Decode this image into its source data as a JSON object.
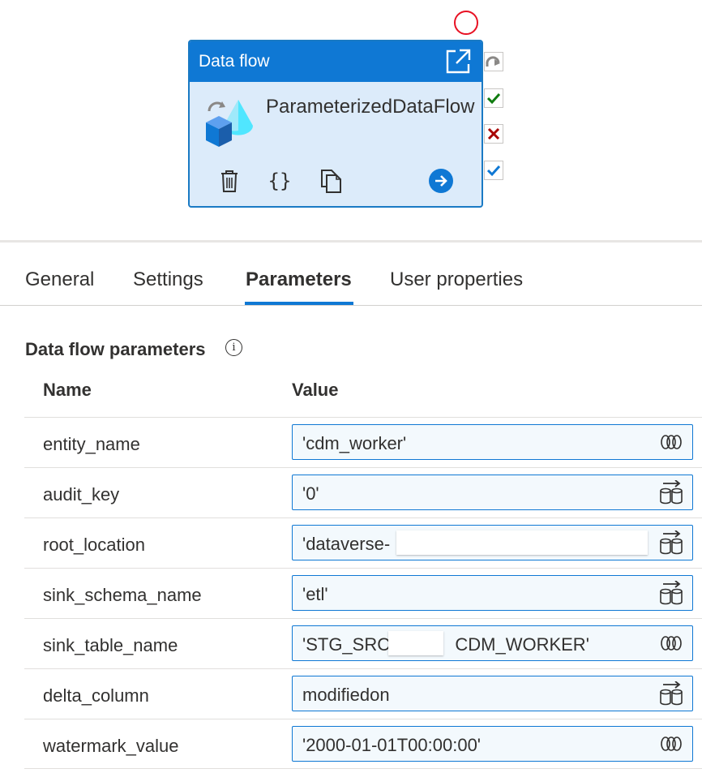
{
  "activity_card": {
    "header_title": "Data flow",
    "activity_name": "ParameterizedDataFlow",
    "status": "not-run",
    "header_icon": "open-external-icon",
    "body_icon": "data-flow-icon",
    "actions": [
      "delete-icon",
      "code-braces-icon",
      "copy-icon",
      "go-arrow-icon"
    ],
    "side_outputs": [
      "skipped-icon",
      "success-icon",
      "failure-icon",
      "completion-icon"
    ],
    "colors": {
      "header": "#0f78d4",
      "body": "#dcebfa",
      "success": "#107c10",
      "failure": "#a80000",
      "completion": "#0f78d4",
      "status_ring": "#e81123"
    }
  },
  "tabs": [
    {
      "label": "General",
      "active": false
    },
    {
      "label": "Settings",
      "active": false
    },
    {
      "label": "Parameters",
      "active": true
    },
    {
      "label": "User properties",
      "active": false
    }
  ],
  "parameters": {
    "section_title": "Data flow parameters",
    "columns": {
      "name": "Name",
      "value": "Value"
    },
    "rows": [
      {
        "name": "entity_name",
        "value": "'cdm_worker'",
        "mode": "expression-icon"
      },
      {
        "name": "audit_key",
        "value": "'0'",
        "mode": "pipeline-expression-icon"
      },
      {
        "name": "root_location",
        "value": "'dataverse-",
        "mode": "pipeline-expression-icon"
      },
      {
        "name": "sink_schema_name",
        "value": "'etl'",
        "mode": "pipeline-expression-icon"
      },
      {
        "name": "sink_table_name",
        "value": "'STG_SRC_",
        "value_suffix": "CDM_WORKER'",
        "mode": "expression-icon"
      },
      {
        "name": "delta_column",
        "value": "modifiedon",
        "mode": "pipeline-expression-icon"
      },
      {
        "name": "watermark_value",
        "value": "'2000-01-01T00:00:00'",
        "mode": "expression-icon"
      }
    ]
  }
}
